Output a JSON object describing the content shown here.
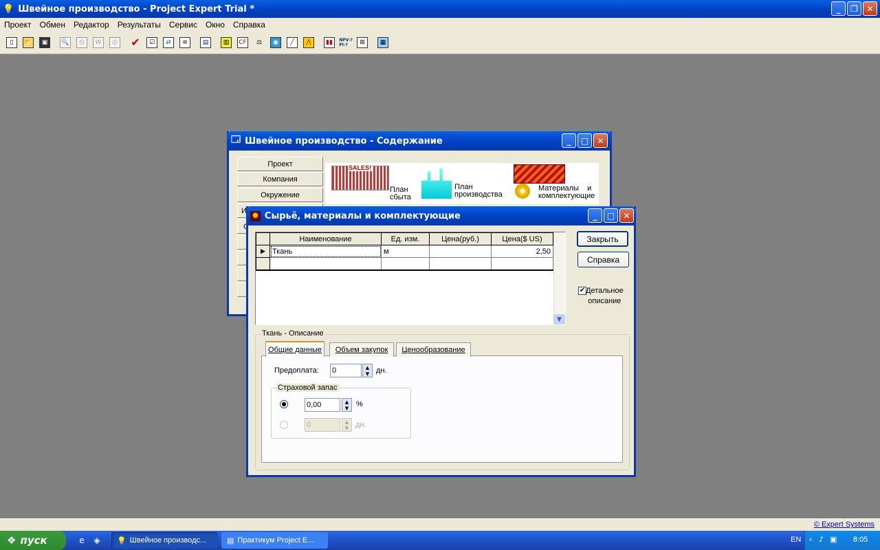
{
  "app": {
    "title": "Швейное производство - Project Expert Trial *"
  },
  "menu": [
    "Проект",
    "Обмен",
    "Редактор",
    "Результаты",
    "Сервис",
    "Окно",
    "Справка"
  ],
  "toolbar": {
    "icons": [
      "new-file-icon",
      "open-folder-icon",
      "save-icon",
      "preview-icon",
      "print-icon",
      "word-icon",
      "archive-icon",
      "check-icon",
      "checklist-icon",
      "transfer-icon",
      "notes-icon",
      "report-icon",
      "list-icon",
      "calc-icon",
      "balance-icon",
      "browse-icon",
      "chart-icon",
      "graph-icon",
      "stats-icon",
      "npv-icon",
      "tree-icon",
      "table-icon"
    ],
    "npv_label": "NPV-?\nPI-?"
  },
  "contents_window": {
    "title": "Швейное производство - Содержание",
    "nav": [
      "Проект",
      "Компания",
      "Окружение"
    ],
    "partial_letters": [
      "И",
      "О"
    ],
    "sections": [
      {
        "label": "План\nсбыта",
        "banner": "SALES!"
      },
      {
        "label": "План\nпроизводства"
      },
      {
        "label": "Материалы    и\nкомплектующие"
      }
    ]
  },
  "materials_dialog": {
    "title": "Сырьё, материалы и комплектующие",
    "columns": [
      "Наименование",
      "Ед. изм.",
      "Цена(руб.)",
      "Цена($ US)"
    ],
    "rows": [
      {
        "name": "Ткань",
        "unit": "м",
        "price_rub": "",
        "price_usd": "2,50"
      },
      {
        "name": "",
        "unit": "",
        "price_rub": "",
        "price_usd": ""
      }
    ],
    "close_button": "Закрыть",
    "help_button": "Справка",
    "detail_checkbox": {
      "label": "Детальное\nописание",
      "checked": true
    },
    "description_group": "Ткань - Описание",
    "tabs": [
      "Общие данные",
      "Объем закупок",
      "Ценообразование"
    ],
    "prepayment": {
      "label": "Предоплата:",
      "value": "0",
      "unit": "дн."
    },
    "safety_stock": {
      "title": "Страховой запас",
      "percent_value": "0,00",
      "percent_unit": "%",
      "days_value": "0",
      "days_unit": "дн."
    }
  },
  "statusbar": {
    "copyright": "© Expert Systems"
  },
  "taskbar": {
    "start": "пуск",
    "tasks": [
      "Швейное производс...",
      "Практикум Project E..."
    ],
    "lang": "EN",
    "time": "8:05"
  }
}
